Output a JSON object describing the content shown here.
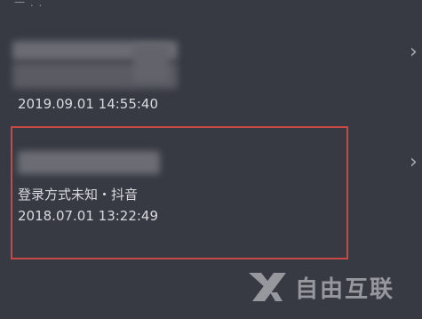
{
  "list": {
    "top_fragment": "一 . .",
    "items": [
      {
        "login_method": "",
        "timestamp": "2019.09.01 14:55:40",
        "chevron_glyph": "›"
      },
      {
        "login_method": "登录方式未知・抖音",
        "timestamp": "2018.07.01 13:22:49",
        "chevron_glyph": "›"
      }
    ]
  },
  "annotation": {
    "highlight_color": "#c84848"
  },
  "watermark": {
    "text": "自由互联",
    "logo_icon": "x-logo-icon"
  },
  "colors": {
    "background": "#373943",
    "text": "#d9dadd",
    "chevron": "#a9aab0"
  }
}
